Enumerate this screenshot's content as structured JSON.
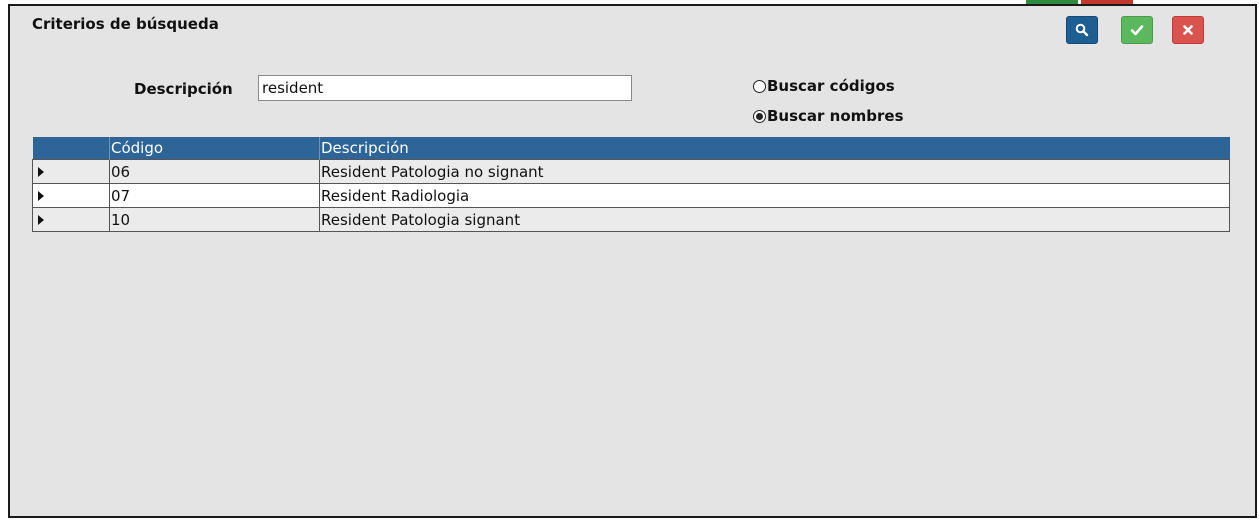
{
  "dialog": {
    "title": "Criterios de búsqueda",
    "buttons": {
      "search_icon": "search-icon",
      "accept_icon": "check-icon",
      "cancel_icon": "close-icon"
    }
  },
  "form": {
    "description_label": "Descripción",
    "description_value": "resident",
    "radio_codes_label": "Buscar códigos",
    "radio_names_label": "Buscar nombres",
    "selected_option": "Buscar nombres"
  },
  "table": {
    "headers": [
      "",
      "Código",
      "Descripción"
    ],
    "rows": [
      {
        "code": "06",
        "description": "Resident Patologia no signant"
      },
      {
        "code": "07",
        "description": "Resident Radiologia"
      },
      {
        "code": "10",
        "description": "Resident Patologia signant"
      }
    ]
  },
  "colors": {
    "header_bg": "#2e6598",
    "search_button": "#1e5f93",
    "accept_button": "#5cb85c",
    "cancel_button": "#d9534f",
    "panel_bg": "#e4e4e4"
  }
}
